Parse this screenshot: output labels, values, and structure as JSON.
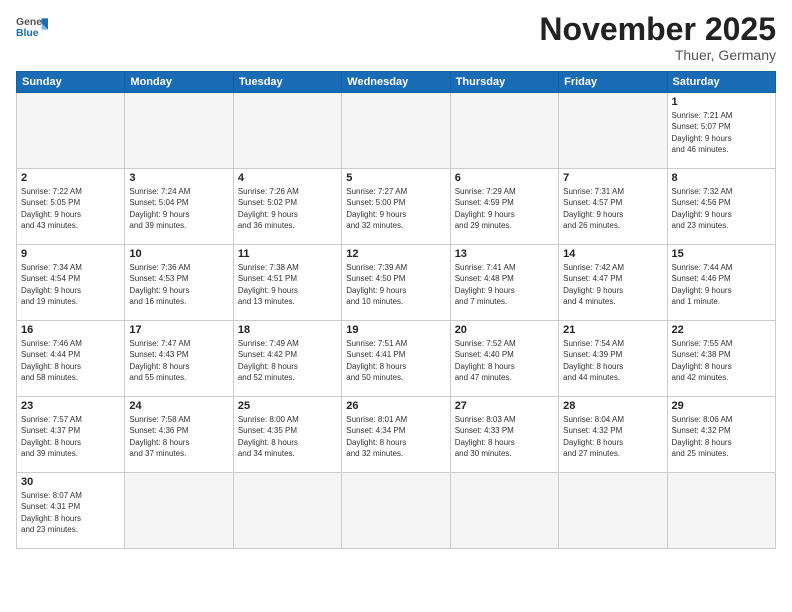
{
  "logo": {
    "general": "General",
    "blue": "Blue"
  },
  "header": {
    "title": "November 2025",
    "location": "Thuer, Germany"
  },
  "weekdays": [
    "Sunday",
    "Monday",
    "Tuesday",
    "Wednesday",
    "Thursday",
    "Friday",
    "Saturday"
  ],
  "days": [
    {
      "num": "",
      "info": ""
    },
    {
      "num": "",
      "info": ""
    },
    {
      "num": "",
      "info": ""
    },
    {
      "num": "",
      "info": ""
    },
    {
      "num": "",
      "info": ""
    },
    {
      "num": "",
      "info": ""
    },
    {
      "num": "1",
      "info": "Sunrise: 7:21 AM\nSunset: 5:07 PM\nDaylight: 9 hours\nand 46 minutes."
    },
    {
      "num": "2",
      "info": "Sunrise: 7:22 AM\nSunset: 5:05 PM\nDaylight: 9 hours\nand 43 minutes."
    },
    {
      "num": "3",
      "info": "Sunrise: 7:24 AM\nSunset: 5:04 PM\nDaylight: 9 hours\nand 39 minutes."
    },
    {
      "num": "4",
      "info": "Sunrise: 7:26 AM\nSunset: 5:02 PM\nDaylight: 9 hours\nand 36 minutes."
    },
    {
      "num": "5",
      "info": "Sunrise: 7:27 AM\nSunset: 5:00 PM\nDaylight: 9 hours\nand 32 minutes."
    },
    {
      "num": "6",
      "info": "Sunrise: 7:29 AM\nSunset: 4:59 PM\nDaylight: 9 hours\nand 29 minutes."
    },
    {
      "num": "7",
      "info": "Sunrise: 7:31 AM\nSunset: 4:57 PM\nDaylight: 9 hours\nand 26 minutes."
    },
    {
      "num": "8",
      "info": "Sunrise: 7:32 AM\nSunset: 4:56 PM\nDaylight: 9 hours\nand 23 minutes."
    },
    {
      "num": "9",
      "info": "Sunrise: 7:34 AM\nSunset: 4:54 PM\nDaylight: 9 hours\nand 19 minutes."
    },
    {
      "num": "10",
      "info": "Sunrise: 7:36 AM\nSunset: 4:53 PM\nDaylight: 9 hours\nand 16 minutes."
    },
    {
      "num": "11",
      "info": "Sunrise: 7:38 AM\nSunset: 4:51 PM\nDaylight: 9 hours\nand 13 minutes."
    },
    {
      "num": "12",
      "info": "Sunrise: 7:39 AM\nSunset: 4:50 PM\nDaylight: 9 hours\nand 10 minutes."
    },
    {
      "num": "13",
      "info": "Sunrise: 7:41 AM\nSunset: 4:48 PM\nDaylight: 9 hours\nand 7 minutes."
    },
    {
      "num": "14",
      "info": "Sunrise: 7:42 AM\nSunset: 4:47 PM\nDaylight: 9 hours\nand 4 minutes."
    },
    {
      "num": "15",
      "info": "Sunrise: 7:44 AM\nSunset: 4:46 PM\nDaylight: 9 hours\nand 1 minute."
    },
    {
      "num": "16",
      "info": "Sunrise: 7:46 AM\nSunset: 4:44 PM\nDaylight: 8 hours\nand 58 minutes."
    },
    {
      "num": "17",
      "info": "Sunrise: 7:47 AM\nSunset: 4:43 PM\nDaylight: 8 hours\nand 55 minutes."
    },
    {
      "num": "18",
      "info": "Sunrise: 7:49 AM\nSunset: 4:42 PM\nDaylight: 8 hours\nand 52 minutes."
    },
    {
      "num": "19",
      "info": "Sunrise: 7:51 AM\nSunset: 4:41 PM\nDaylight: 8 hours\nand 50 minutes."
    },
    {
      "num": "20",
      "info": "Sunrise: 7:52 AM\nSunset: 4:40 PM\nDaylight: 8 hours\nand 47 minutes."
    },
    {
      "num": "21",
      "info": "Sunrise: 7:54 AM\nSunset: 4:39 PM\nDaylight: 8 hours\nand 44 minutes."
    },
    {
      "num": "22",
      "info": "Sunrise: 7:55 AM\nSunset: 4:38 PM\nDaylight: 8 hours\nand 42 minutes."
    },
    {
      "num": "23",
      "info": "Sunrise: 7:57 AM\nSunset: 4:37 PM\nDaylight: 8 hours\nand 39 minutes."
    },
    {
      "num": "24",
      "info": "Sunrise: 7:58 AM\nSunset: 4:36 PM\nDaylight: 8 hours\nand 37 minutes."
    },
    {
      "num": "25",
      "info": "Sunrise: 8:00 AM\nSunset: 4:35 PM\nDaylight: 8 hours\nand 34 minutes."
    },
    {
      "num": "26",
      "info": "Sunrise: 8:01 AM\nSunset: 4:34 PM\nDaylight: 8 hours\nand 32 minutes."
    },
    {
      "num": "27",
      "info": "Sunrise: 8:03 AM\nSunset: 4:33 PM\nDaylight: 8 hours\nand 30 minutes."
    },
    {
      "num": "28",
      "info": "Sunrise: 8:04 AM\nSunset: 4:32 PM\nDaylight: 8 hours\nand 27 minutes."
    },
    {
      "num": "29",
      "info": "Sunrise: 8:06 AM\nSunset: 4:32 PM\nDaylight: 8 hours\nand 25 minutes."
    },
    {
      "num": "30",
      "info": "Sunrise: 8:07 AM\nSunset: 4:31 PM\nDaylight: 8 hours\nand 23 minutes."
    },
    {
      "num": "",
      "info": ""
    },
    {
      "num": "",
      "info": ""
    },
    {
      "num": "",
      "info": ""
    },
    {
      "num": "",
      "info": ""
    },
    {
      "num": "",
      "info": ""
    },
    {
      "num": "",
      "info": ""
    }
  ]
}
